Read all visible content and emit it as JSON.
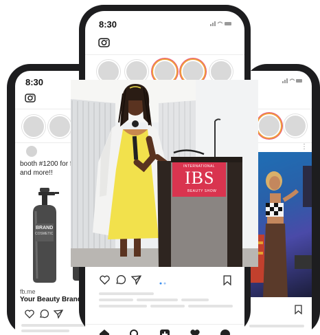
{
  "left_phone": {
    "time": "8:30",
    "post_text": "booth #1200 for fre\nand more!!",
    "link_domain": "fb.me",
    "link_title": "Your Beauty Brand",
    "product_brand": "BRAND",
    "product_subtitle": "COSMETIC"
  },
  "center_phone": {
    "time": "8:30",
    "status_icons": "signal-wifi-battery"
  },
  "right_phone": {
    "status_icons": "signal-wifi-battery"
  },
  "photo": {
    "podium_line1": "INTERNATIONAL",
    "podium_logo": "IBS",
    "podium_line2": "BEAUTY SHOW",
    "accent": "#d9344f",
    "dress": "#f2e14c"
  },
  "icons": [
    "camera-icon",
    "heart-icon",
    "comment-icon",
    "share-icon",
    "bookmark-icon",
    "home-icon",
    "search-icon",
    "add-icon",
    "activity-icon",
    "profile-icon"
  ]
}
